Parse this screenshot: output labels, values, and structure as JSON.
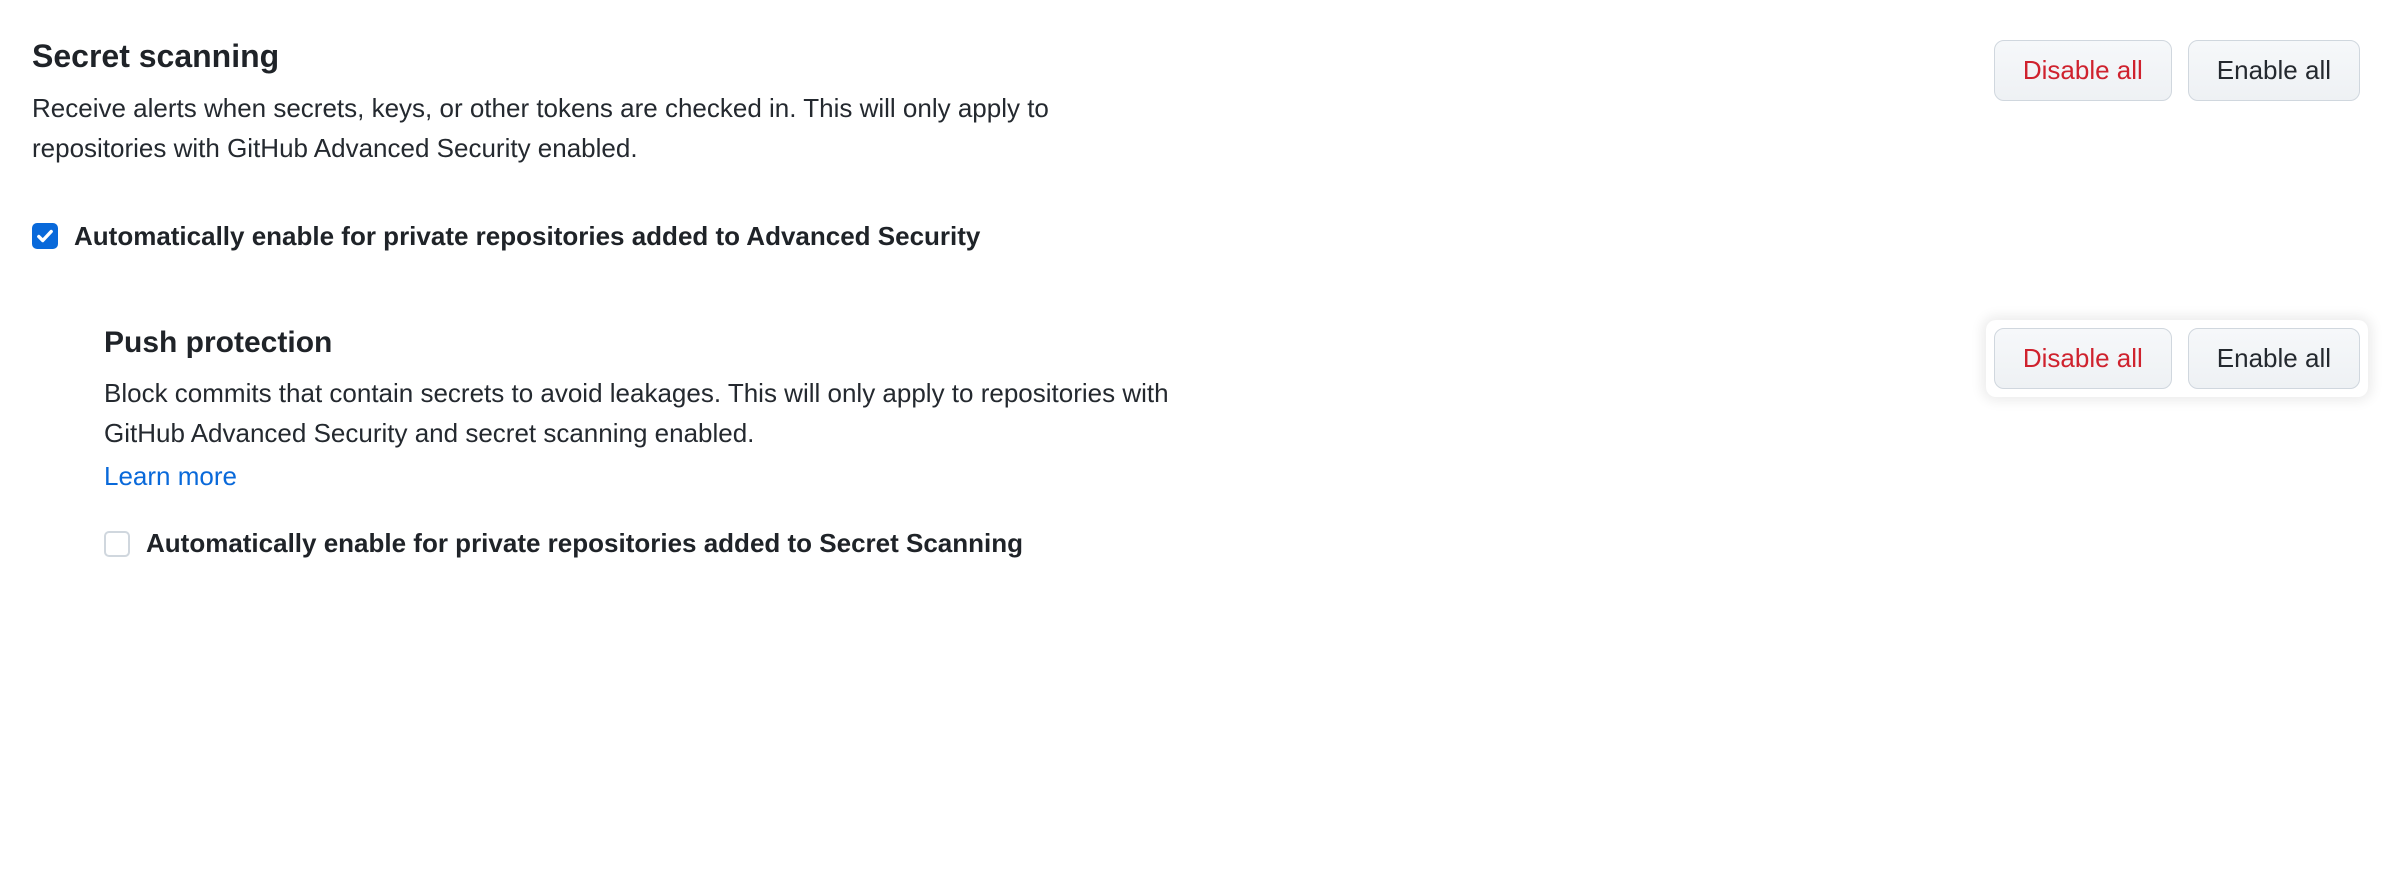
{
  "secret_scanning": {
    "title": "Secret scanning",
    "description": "Receive alerts when secrets, keys, or other tokens are checked in. This will only apply to repositories with GitHub Advanced Security enabled.",
    "disable_all_label": "Disable all",
    "enable_all_label": "Enable all",
    "auto_enable_checked": true,
    "auto_enable_label": "Automatically enable for private repositories added to Advanced Security"
  },
  "push_protection": {
    "title": "Push protection",
    "description": "Block commits that contain secrets to avoid leakages. This will only apply to repositories with GitHub Advanced Security and secret scanning enabled.",
    "learn_more_label": "Learn more",
    "disable_all_label": "Disable all",
    "enable_all_label": "Enable all",
    "auto_enable_checked": false,
    "auto_enable_label": "Automatically enable for private repositories added to Secret Scanning"
  }
}
